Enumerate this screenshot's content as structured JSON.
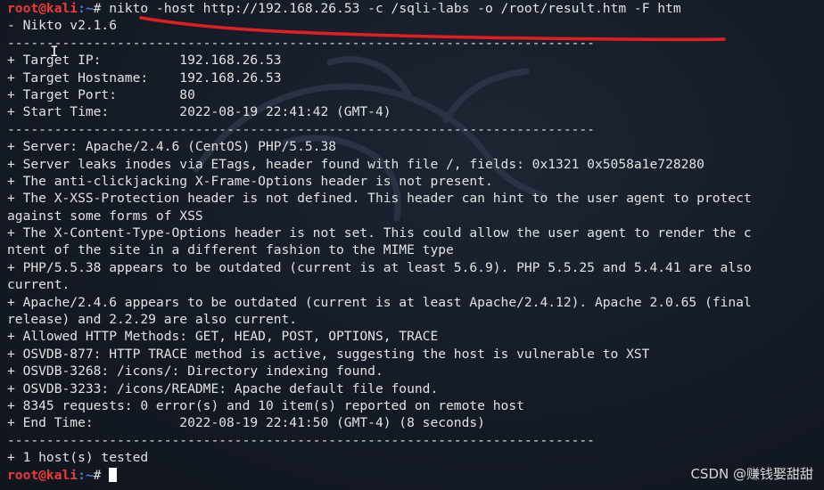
{
  "terminal": {
    "prompt": {
      "user_host": "root@kali",
      "path": ":~",
      "symbol": "# "
    },
    "command": "nikto -host http://192.168.26.53 -c /sqli-labs -o /root/result.htm -F htm",
    "output_lines": [
      "- Nikto v2.1.6",
      "---------------------------------------------------------------------------",
      "+ Target IP:          192.168.26.53",
      "+ Target Hostname:    192.168.26.53",
      "+ Target Port:        80",
      "+ Start Time:         2022-08-19 22:41:42 (GMT-4)",
      "---------------------------------------------------------------------------",
      "+ Server: Apache/2.4.6 (CentOS) PHP/5.5.38",
      "+ Server leaks inodes via ETags, header found with file /, fields: 0x1321 0x5058a1e728280",
      "+ The anti-clickjacking X-Frame-Options header is not present.",
      "+ The X-XSS-Protection header is not defined. This header can hint to the user agent to protect",
      "against some forms of XSS",
      "+ The X-Content-Type-Options header is not set. This could allow the user agent to render the c",
      "ntent of the site in a different fashion to the MIME type",
      "+ PHP/5.5.38 appears to be outdated (current is at least 5.6.9). PHP 5.5.25 and 5.4.41 are also",
      "current.",
      "+ Apache/2.4.6 appears to be outdated (current is at least Apache/2.4.12). Apache 2.0.65 (final",
      "release) and 2.2.29 are also current.",
      "+ Allowed HTTP Methods: GET, HEAD, POST, OPTIONS, TRACE",
      "+ OSVDB-877: HTTP TRACE method is active, suggesting the host is vulnerable to XST",
      "+ OSVDB-3268: /icons/: Directory indexing found.",
      "+ OSVDB-3233: /icons/README: Apache default file found.",
      "+ 8345 requests: 0 error(s) and 10 item(s) reported on remote host",
      "+ End Time:           2022-08-19 22:41:50 (GMT-4) (8 seconds)",
      "---------------------------------------------------------------------------",
      "+ 1 host(s) tested"
    ]
  },
  "watermark": "CSDN @赚钱娶甜甜",
  "colors": {
    "background": "#151b25",
    "text": "#e2e2e2",
    "prompt_user": "#ef3a3a",
    "prompt_path": "#4b7ad8",
    "annotation": "#e02020"
  }
}
